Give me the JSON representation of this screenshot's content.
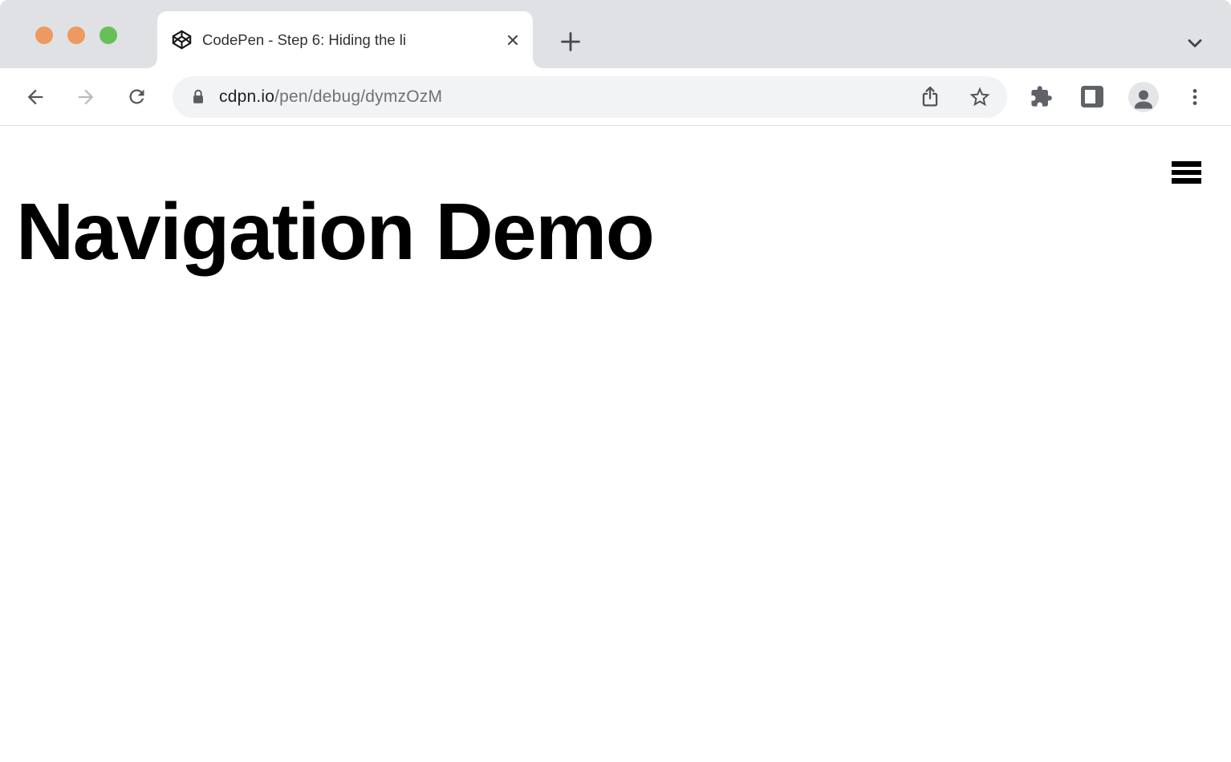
{
  "window": {
    "controls": {
      "close_color": "#EC9A5F",
      "minimize_color": "#EC9A5F",
      "zoom_color": "#68BF58"
    }
  },
  "tab_strip": {
    "tab_title": "CodePen - Step 6: Hiding the li",
    "icons": {
      "favicon": "codepen-cube-icon",
      "close": "close-x-icon",
      "new_tab": "plus-icon",
      "tab_list": "chevron-down-icon"
    }
  },
  "toolbar": {
    "forward_enabled": false,
    "icons": {
      "back": "arrow-left-icon",
      "forward": "arrow-right-icon",
      "reload": "reload-icon",
      "extensions": "puzzle-piece-icon",
      "side_panel": "side-panel-icon",
      "profile": "person-avatar-icon",
      "menu": "kebab-menu-icon"
    },
    "address_bar": {
      "lock_icon": "padlock-icon",
      "domain": "cdpn.io",
      "path": "/pen/debug/dymzOzM",
      "share_icon": "share-up-arrow-icon",
      "bookmark_icon": "star-icon"
    }
  },
  "page": {
    "heading": "Navigation Demo",
    "menu_icon": "hamburger-icon"
  },
  "colors": {
    "tab_strip_bg": "#DFE1E5",
    "toolbar_bg": "#FFFFFF",
    "omnibox_bg": "#F1F3F4",
    "icon_gray": "#5F6368",
    "icon_dark": "#4B4F54",
    "disabled_gray": "#B8BCC1",
    "url_domain": "#202124",
    "url_path": "#6E7276",
    "divider": "#DBDDE0",
    "heading_text": "#000000"
  }
}
